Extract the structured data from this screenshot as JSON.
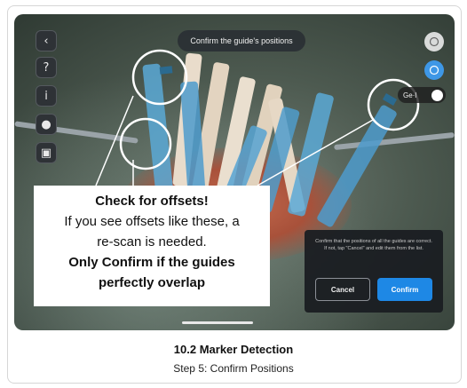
{
  "top_pill": {
    "text": "Confirm the guide's positions"
  },
  "side_toolbar": {
    "back_icon": "‹",
    "help_icon": "?",
    "info_icon": "i",
    "record_icon": "●",
    "camera_icon": "▣"
  },
  "right_toolbar": {
    "toggle_label": "Ge·l"
  },
  "annotation": {
    "line1": "Check for offsets!",
    "line2": "If you see offsets like these, a",
    "line3": "re-scan is needed.",
    "line4": "Only Confirm if the guides",
    "line5": "perfectly overlap"
  },
  "dialog": {
    "message": "Confirm that the positions of all the guides are correct. If not, tap \"Cancel\" and edit them from the list.",
    "cancel_label": "Cancel",
    "confirm_label": "Confirm"
  },
  "caption": {
    "title": "10.2 Marker Detection",
    "subtitle": "Step 5: Confirm Positions"
  },
  "colors": {
    "confirm_blue": "#1e88e5",
    "guide_blue": "#5aa9d6",
    "guide_beige": "#e9dccb",
    "wound_red": "#b35a40"
  }
}
